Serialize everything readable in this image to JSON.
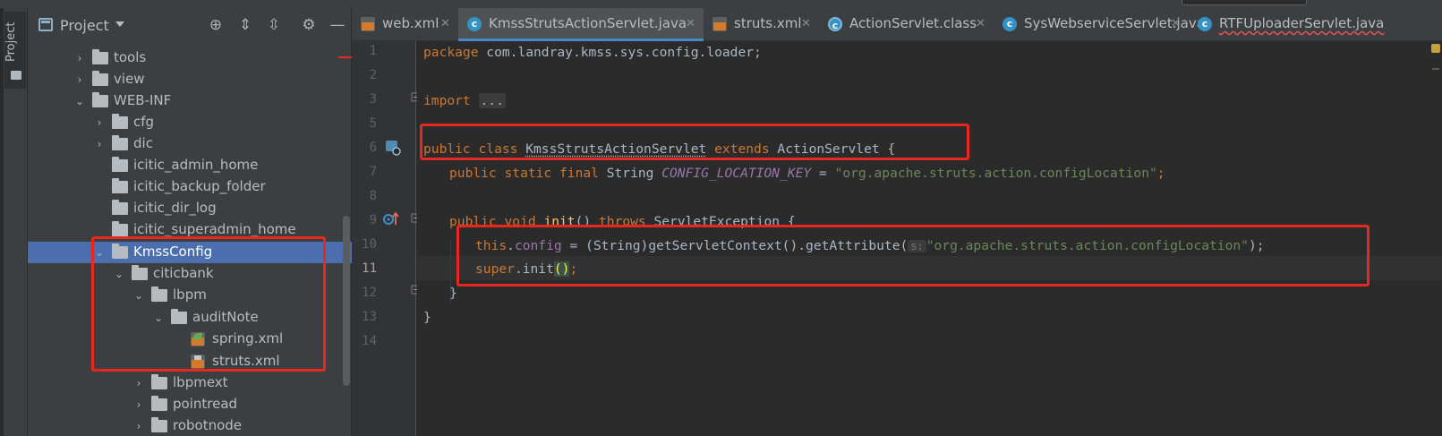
{
  "panel": {
    "title": "Project",
    "stripe_label": "Project",
    "tree": [
      {
        "label": "tools",
        "depth": 0,
        "arrow": "›",
        "kind": "folder"
      },
      {
        "label": "view",
        "depth": 0,
        "arrow": "›",
        "kind": "folder"
      },
      {
        "label": "WEB-INF",
        "depth": 0,
        "arrow": "⌄",
        "kind": "folder"
      },
      {
        "label": "cfg",
        "depth": 1,
        "arrow": "›",
        "kind": "folder"
      },
      {
        "label": "dic",
        "depth": 1,
        "arrow": "›",
        "kind": "folder"
      },
      {
        "label": "icitic_admin_home",
        "depth": 1,
        "arrow": "",
        "kind": "folder"
      },
      {
        "label": "icitic_backup_folder",
        "depth": 1,
        "arrow": "",
        "kind": "folder"
      },
      {
        "label": "icitic_dir_log",
        "depth": 1,
        "arrow": "",
        "kind": "folder"
      },
      {
        "label": "icitic_superadmin_home",
        "depth": 1,
        "arrow": "",
        "kind": "folder"
      },
      {
        "label": "KmssConfig",
        "depth": 1,
        "arrow": "⌄",
        "kind": "folder",
        "selected": true
      },
      {
        "label": "citicbank",
        "depth": 2,
        "arrow": "⌄",
        "kind": "folder"
      },
      {
        "label": "lbpm",
        "depth": 3,
        "arrow": "⌄",
        "kind": "folder"
      },
      {
        "label": "auditNote",
        "depth": 4,
        "arrow": "⌄",
        "kind": "folder"
      },
      {
        "label": "spring.xml",
        "depth": 5,
        "arrow": "",
        "kind": "spring-xml"
      },
      {
        "label": "struts.xml",
        "depth": 5,
        "arrow": "",
        "kind": "xml"
      },
      {
        "label": "lbpmext",
        "depth": 3,
        "arrow": "›",
        "kind": "folder"
      },
      {
        "label": "pointread",
        "depth": 3,
        "arrow": "›",
        "kind": "folder"
      },
      {
        "label": "robotnode",
        "depth": 3,
        "arrow": "›",
        "kind": "folder"
      }
    ]
  },
  "tabs": [
    {
      "label": "web.xml",
      "icon": "xml-file-icon",
      "active": false,
      "error": false
    },
    {
      "label": "KmssStrutsActionServlet.java",
      "icon": "java-class-icon",
      "active": true,
      "error": false
    },
    {
      "label": "struts.xml",
      "icon": "xml-file-icon",
      "active": false,
      "error": false
    },
    {
      "label": "ActionServlet.class",
      "icon": "compiled-class-icon",
      "active": false,
      "error": false
    },
    {
      "label": "SysWebserviceServlet.java",
      "icon": "java-class-icon",
      "active": false,
      "error": false
    },
    {
      "label": "RTFUploaderServlet.java",
      "icon": "java-class-icon",
      "active": false,
      "error": true
    }
  ],
  "editor": {
    "line_numbers": [
      "1",
      "2",
      "3",
      "5",
      "6",
      "7",
      "8",
      "9",
      "10",
      "11",
      "12",
      "13",
      "14"
    ],
    "current_line": "11",
    "code": {
      "l1_kw": "package",
      "l1_rest": " com.landray.kmss.sys.config.loader;",
      "l3_kw": "import",
      "l3_fold": "...",
      "l6_kw1": "public class",
      "l6_cls": "KmssStrutsActionServlet",
      "l6_kw2": "extends",
      "l6_rest": " ActionServlet {",
      "l7_kw": "public static final",
      "l7_type": " String ",
      "l7_const": "CONFIG_LOCATION_KEY",
      "l7_eq": " = ",
      "l7_str": "\"org.apache.struts.action.configLocation\"",
      "l7_end": ";",
      "l9_kw1": "public void",
      "l9_fn": "init",
      "l9_mid": "() ",
      "l9_kw2": "throws",
      "l9_rest": " ServletException {",
      "l10_kw": "this",
      "l10_dot": ".",
      "l10_fld": "config",
      "l10_mid": " = (String)getServletContext().getAttribute(",
      "l10_hint": "s:",
      "l10_str": "\"org.apache.struts.action.configLocation\"",
      "l10_end": ");",
      "l11_kw": "super",
      "l11_mid": ".init",
      "l11_paren": "()",
      "l11_end": ";",
      "l12": "}",
      "l13": "}"
    }
  },
  "colors": {
    "accent": "#4a88c7",
    "selection": "#4b6eaf",
    "annotation_red": "#e8281f",
    "keyword": "#cc7832",
    "string": "#6a8759"
  }
}
